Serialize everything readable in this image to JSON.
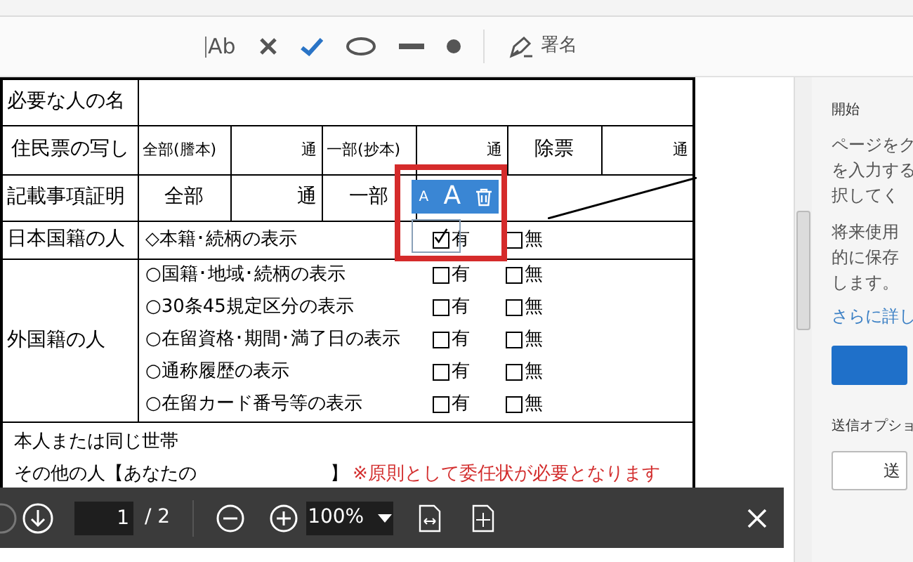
{
  "toolbar": {
    "text_tool_glyph": "Ab",
    "sign_label": "署名"
  },
  "form": {
    "name_row": {
      "label": "必要な人の名"
    },
    "copy_row": {
      "label": "住民票の写し",
      "cells": [
        "全部(謄本)",
        "通",
        "一部(抄本)",
        "通",
        "除票",
        "通"
      ]
    },
    "cert_row": {
      "label": "記載事項証明",
      "cells": [
        "全部",
        "通",
        "一部"
      ]
    },
    "japanese_row": {
      "label": "日本国籍の人",
      "items": [
        {
          "text": "◇本籍･続柄の表示",
          "yes": {
            "label": "有",
            "checked": true
          },
          "no": {
            "label": "無",
            "checked": false
          }
        }
      ]
    },
    "foreign_row": {
      "label": "外国籍の人",
      "items": [
        {
          "text": "○国籍･地域･続柄の表示",
          "yes": {
            "label": "有",
            "checked": false
          },
          "no": {
            "label": "無",
            "checked": false
          }
        },
        {
          "text": "○30条45規定区分の表示",
          "yes": {
            "label": "有",
            "checked": false
          },
          "no": {
            "label": "無",
            "checked": false
          }
        },
        {
          "text": "○在留資格･期間･満了日の表示",
          "yes": {
            "label": "有",
            "checked": false
          },
          "no": {
            "label": "無",
            "checked": false
          }
        },
        {
          "text": "○通称履歴の表示",
          "yes": {
            "label": "有",
            "checked": false
          },
          "no": {
            "label": "無",
            "checked": false
          }
        },
        {
          "text": "○在留カード番号等の表示",
          "yes": {
            "label": "有",
            "checked": false
          },
          "no": {
            "label": "無",
            "checked": false
          }
        }
      ]
    },
    "delegate_row": {
      "line_1": "本人または同じ世帯",
      "line_2": "その他の人【あなたの",
      "bracket": "】",
      "note": "※原則として委任状が必要となります"
    }
  },
  "annotation_toolbar": {
    "small_font": "A",
    "large_font": "A"
  },
  "pager": {
    "current": "1",
    "total": "/ 2",
    "zoom": "100%"
  },
  "side_panel": {
    "heading": "開始",
    "paragraphs": [
      [
        "ページをク",
        "を入力する",
        "択してく"
      ],
      [
        "将来使用",
        "的に保存",
        "します。"
      ]
    ],
    "link": "さらに詳し",
    "section": "送信オプショ",
    "button": "送"
  }
}
